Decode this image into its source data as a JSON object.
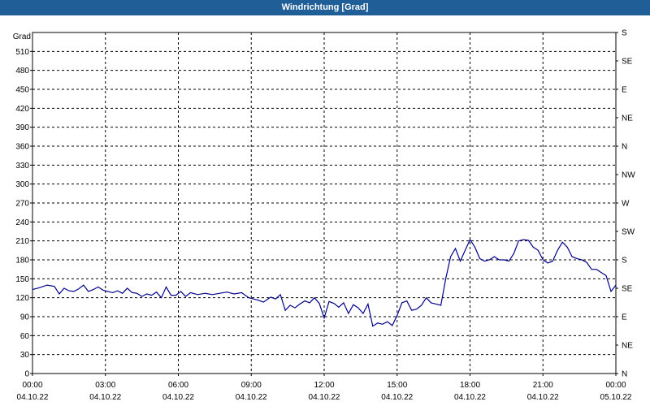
{
  "window": {
    "title": "Windrichtung [Grad]"
  },
  "chart_data": {
    "type": "line",
    "title": "Windrichtung [Grad]",
    "ylabel": "Grad",
    "xlabel": "",
    "ylim": [
      0,
      540
    ],
    "xlim": [
      "2022-10-04T00:00",
      "2022-10-05T00:00"
    ],
    "grid": true,
    "y_ticks": [
      0,
      30,
      60,
      90,
      120,
      150,
      180,
      210,
      240,
      270,
      300,
      330,
      360,
      390,
      420,
      450,
      480,
      510
    ],
    "x_ticks": [
      {
        "time": "00:00",
        "date": "04.10.22"
      },
      {
        "time": "03:00",
        "date": "04.10.22"
      },
      {
        "time": "06:00",
        "date": "04.10.22"
      },
      {
        "time": "09:00",
        "date": "04.10.22"
      },
      {
        "time": "12:00",
        "date": "04.10.22"
      },
      {
        "time": "15:00",
        "date": "04.10.22"
      },
      {
        "time": "18:00",
        "date": "04.10.22"
      },
      {
        "time": "21:00",
        "date": "04.10.22"
      },
      {
        "time": "00:00",
        "date": "05.10.22"
      }
    ],
    "right_axis": [
      {
        "label": "S",
        "value": 540
      },
      {
        "label": "SE",
        "value": 495
      },
      {
        "label": "E",
        "value": 450
      },
      {
        "label": "NE",
        "value": 405
      },
      {
        "label": "N",
        "value": 360
      },
      {
        "label": "NW",
        "value": 315
      },
      {
        "label": "W",
        "value": 270
      },
      {
        "label": "SW",
        "value": 225
      },
      {
        "label": "S",
        "value": 180
      },
      {
        "label": "SE",
        "value": 135
      },
      {
        "label": "E",
        "value": 90
      },
      {
        "label": "NE",
        "value": 45
      },
      {
        "label": "N",
        "value": 0
      }
    ],
    "series": [
      {
        "color": "#00008b",
        "x_hours": [
          0,
          0.3,
          0.6,
          0.9,
          1.1,
          1.3,
          1.5,
          1.7,
          1.9,
          2.1,
          2.3,
          2.5,
          2.7,
          2.9,
          3.1,
          3.3,
          3.5,
          3.7,
          3.9,
          4.1,
          4.3,
          4.5,
          4.7,
          4.9,
          5.1,
          5.3,
          5.5,
          5.7,
          5.9,
          6.1,
          6.3,
          6.5,
          6.8,
          7.1,
          7.4,
          7.7,
          8.0,
          8.3,
          8.6,
          8.9,
          9.1,
          9.3,
          9.5,
          9.8,
          10.0,
          10.2,
          10.4,
          10.6,
          10.8,
          11.0,
          11.2,
          11.4,
          11.6,
          11.8,
          12.0,
          12.2,
          12.4,
          12.6,
          12.8,
          13.0,
          13.2,
          13.4,
          13.6,
          13.8,
          14.0,
          14.2,
          14.4,
          14.6,
          14.8,
          15.0,
          15.2,
          15.4,
          15.6,
          15.8,
          16.0,
          16.2,
          16.4,
          16.6,
          16.8,
          17.0,
          17.2,
          17.4,
          17.6,
          17.8,
          18.0,
          18.2,
          18.4,
          18.6,
          18.8,
          19.0,
          19.2,
          19.4,
          19.6,
          19.8,
          20.0,
          20.2,
          20.4,
          20.6,
          20.8,
          21.0,
          21.2,
          21.4,
          21.6,
          21.8,
          22.0,
          22.2,
          22.4,
          22.6,
          22.8,
          23.0,
          23.2,
          23.4,
          23.6,
          23.8,
          24.0
        ],
        "values": [
          133,
          136,
          140,
          138,
          126,
          135,
          131,
          130,
          134,
          140,
          130,
          133,
          137,
          132,
          130,
          128,
          131,
          127,
          135,
          128,
          127,
          122,
          126,
          124,
          129,
          120,
          137,
          124,
          124,
          130,
          122,
          128,
          125,
          127,
          125,
          127,
          129,
          126,
          128,
          120,
          118,
          116,
          113,
          121,
          118,
          125,
          100,
          108,
          104,
          110,
          115,
          112,
          120,
          111,
          88,
          114,
          111,
          105,
          112,
          95,
          109,
          104,
          95,
          110,
          75,
          80,
          78,
          82,
          76,
          92,
          112,
          115,
          100,
          102,
          108,
          120,
          112,
          110,
          108,
          150,
          185,
          198,
          178,
          195,
          212,
          200,
          182,
          178,
          180,
          185,
          180,
          180,
          178,
          190,
          210,
          212,
          211,
          200,
          195,
          180,
          175,
          178,
          195,
          208,
          200,
          185,
          182,
          180,
          176,
          165,
          165,
          160,
          155,
          130,
          140
        ]
      }
    ]
  }
}
